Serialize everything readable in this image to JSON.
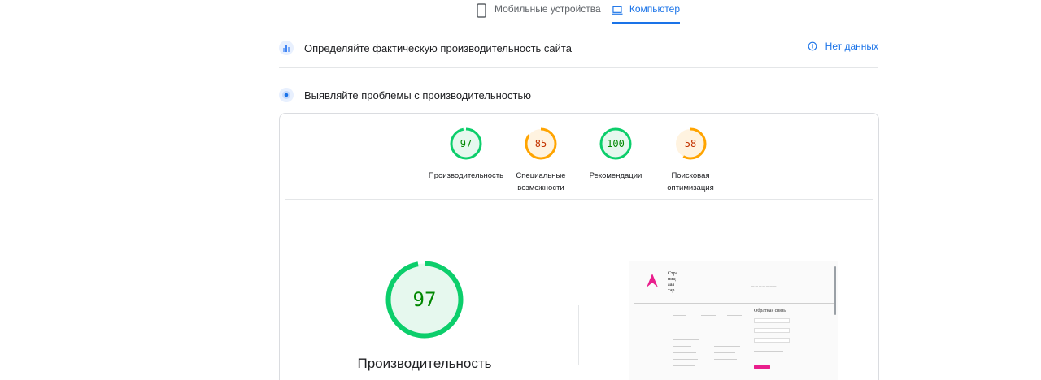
{
  "tabs": {
    "mobile_label": "Мобильные устройства",
    "desktop_label": "Компьютер",
    "active": "desktop"
  },
  "field_section": {
    "title": "Определяйте фактическую производительность сайта",
    "status_label": "Нет данных"
  },
  "lab_section": {
    "title": "Выявляйте проблемы с производительностью"
  },
  "scores": [
    {
      "value": "97",
      "score": 97,
      "label_line1": "Производительность",
      "label_line2": "",
      "status": "pass"
    },
    {
      "value": "85",
      "score": 85,
      "label_line1": "Специальные",
      "label_line2": "возможности",
      "status": "average"
    },
    {
      "value": "100",
      "score": 100,
      "label_line1": "Рекомендации",
      "label_line2": "",
      "status": "pass"
    },
    {
      "value": "58",
      "score": 58,
      "label_line1": "Поисковая",
      "label_line2": "оптимизация",
      "status": "average"
    }
  ],
  "main_score": {
    "value": "97",
    "score": 97,
    "label": "Производительность"
  },
  "colors": {
    "accent": "#1a73e8",
    "pass": "#0cce6b",
    "pass_text": "#008800",
    "pass_fill": "#e6f8ee",
    "average": "#ffa400",
    "average_text": "#c33300",
    "average_fill": "#fff3e0"
  },
  "icons": {
    "mobile": "phone-icon",
    "desktop": "laptop-icon",
    "field": "field-data-icon",
    "lab": "lab-data-icon",
    "info": "info-icon"
  }
}
